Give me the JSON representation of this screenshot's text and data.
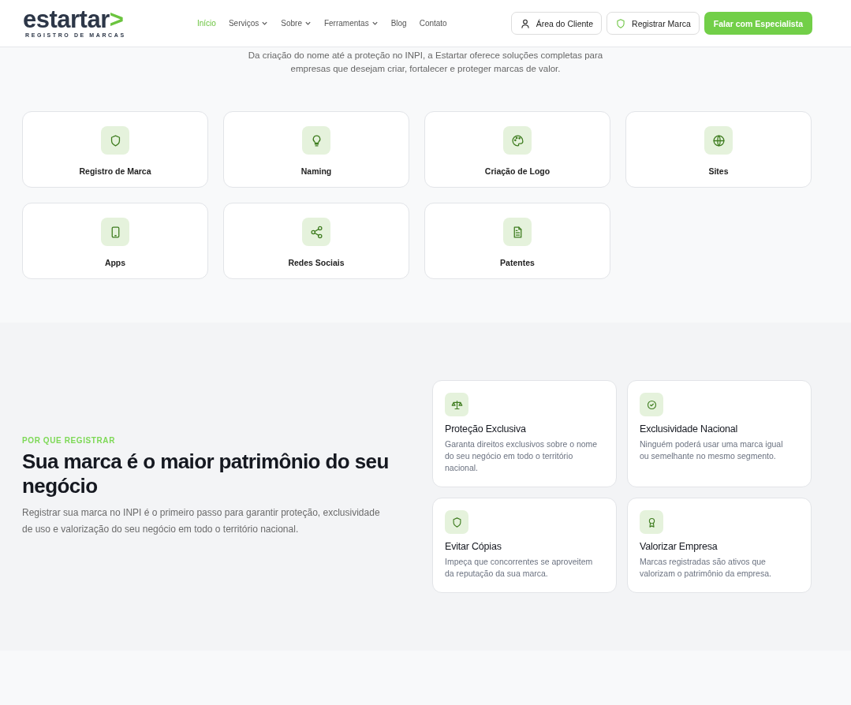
{
  "header": {
    "logo": {
      "name": "estartar",
      "mark": ">",
      "tagline": "REGISTRO DE MARCAS"
    },
    "nav": [
      {
        "label": "Início",
        "selected": true,
        "has_menu": false
      },
      {
        "label": "Serviços",
        "selected": false,
        "has_menu": true
      },
      {
        "label": "Sobre",
        "selected": false,
        "has_menu": true
      },
      {
        "label": "Ferramentas",
        "selected": false,
        "has_menu": true
      },
      {
        "label": "Blog",
        "selected": false,
        "has_menu": false
      },
      {
        "label": "Contato",
        "selected": false,
        "has_menu": false
      }
    ],
    "buttons": [
      {
        "label": "Área do Cliente",
        "kind": "outline"
      },
      {
        "label": "Registrar Marca",
        "kind": "outline"
      },
      {
        "label": "Falar com Especialista",
        "kind": "primary"
      }
    ]
  },
  "services": {
    "intro": "Da criação do nome até a proteção no INPI, a Estartar oferece soluções completas para empresas que desejam criar, fortalecer e proteger marcas de valor.",
    "cards": [
      {
        "title": "Registro de Marca",
        "kind": "shield"
      },
      {
        "title": "Naming",
        "kind": "bulb"
      },
      {
        "title": "Criação de Logo",
        "kind": "palette"
      },
      {
        "title": "Sites",
        "kind": "globe"
      },
      {
        "title": "Apps",
        "kind": "phone"
      },
      {
        "title": "Redes Sociais",
        "kind": "share"
      },
      {
        "title": "Patentes",
        "kind": "doc"
      }
    ]
  },
  "why": {
    "eyebrow": "POR QUE REGISTRAR",
    "heading": "Sua marca é o maior patrimônio do seu negócio",
    "text": "Registrar sua marca no INPI é o primeiro passo para garantir proteção, exclusividade de uso e valorização do seu negócio em todo o território nacional.",
    "benefits": [
      {
        "title": "Proteção Exclusiva",
        "text": "Garanta direitos exclusivos sobre o nome do seu negócio em todo o território nacional.",
        "kind": "scale"
      },
      {
        "title": "Exclusividade Nacional",
        "text": "Ninguém poderá usar uma marca igual ou semelhante no mesmo segmento.",
        "kind": "check"
      },
      {
        "title": "Evitar Cópias",
        "text": "Impeça que concorrentes se aproveitem da reputação da sua marca.",
        "kind": "shield"
      },
      {
        "title": "Valorizar Empresa",
        "text": "Marcas registradas são ativos que valorizam o patrimônio da empresa.",
        "kind": "award"
      }
    ]
  }
}
